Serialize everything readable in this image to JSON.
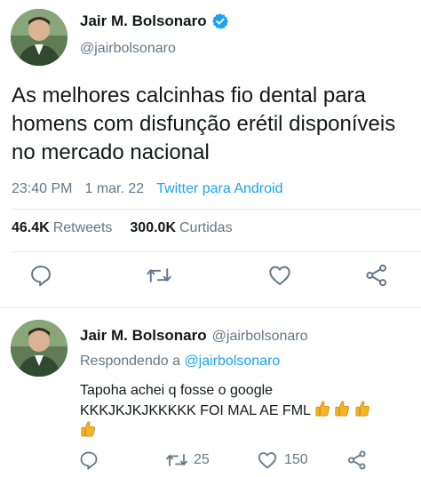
{
  "main_tweet": {
    "display_name": "Jair M. Bolsonaro",
    "handle": "@jairbolsonaro",
    "text": "As melhores calcinhas fio dental para homens com disfunção erétil disponíveis no mercado nacional",
    "time": "23:40 PM",
    "date": "1 mar. 22",
    "client": "Twitter para Android",
    "retweets_count": "46.4K",
    "retweets_label": "Retweets",
    "likes_count": "300.0K",
    "likes_label": "Curtidas"
  },
  "reply_tweet": {
    "display_name": "Jair M. Bolsonaro",
    "handle": "@jairbolsonaro",
    "replying_prefix": "Respondendo a",
    "replying_to": "@jairbolsonaro",
    "text_line1": "Tapoha achei q fosse o google",
    "text_line2": "KKKJKJKJKKKKK FOI MAL AE FML",
    "retweets_count": "25",
    "likes_count": "150"
  },
  "colors": {
    "link_blue": "#1da1f2",
    "secondary_gray": "#657786",
    "text_dark": "#14171a",
    "divider": "#e1e8ed",
    "thumb_yellow": "#f5b325"
  },
  "icons": [
    "verified-badge-icon",
    "reply-icon",
    "retweet-icon",
    "like-icon",
    "share-icon",
    "thumbs-up-emoji"
  ]
}
